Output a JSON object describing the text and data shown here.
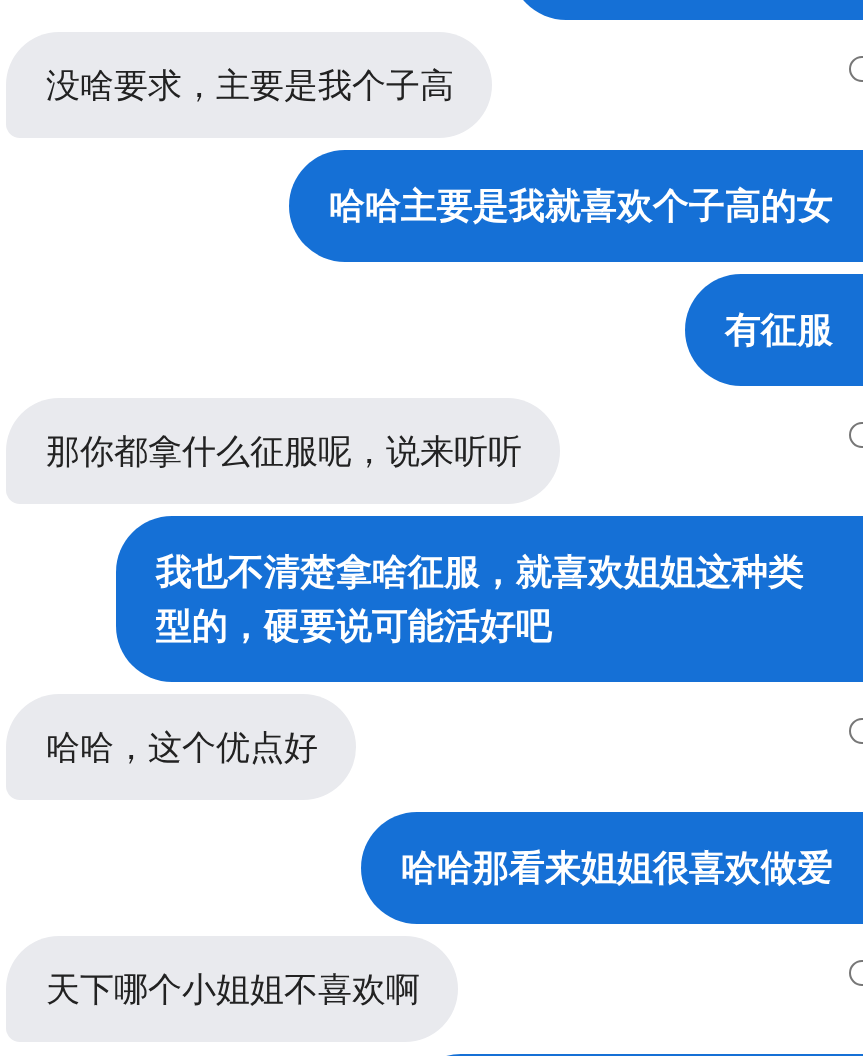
{
  "messages": [
    {
      "kind": "sent"
    },
    {
      "kind": "received",
      "text": "没啥要求，主要是我个子高"
    },
    {
      "kind": "sent",
      "text": "哈哈主要是我就喜欢个子高的女"
    },
    {
      "kind": "sent",
      "text": "有征服"
    },
    {
      "kind": "received",
      "text": "那你都拿什么征服呢，说来听听"
    },
    {
      "kind": "sent",
      "text": "我也不清楚拿啥征服，就喜欢姐姐这种类型的，硬要说可能活好吧"
    },
    {
      "kind": "received",
      "text": "哈哈，这个优点好"
    },
    {
      "kind": "sent",
      "text": "哈哈那看来姐姐很喜欢做爱"
    },
    {
      "kind": "received",
      "text": "天下哪个小姐姐不喜欢啊"
    },
    {
      "kind": "sent"
    }
  ]
}
